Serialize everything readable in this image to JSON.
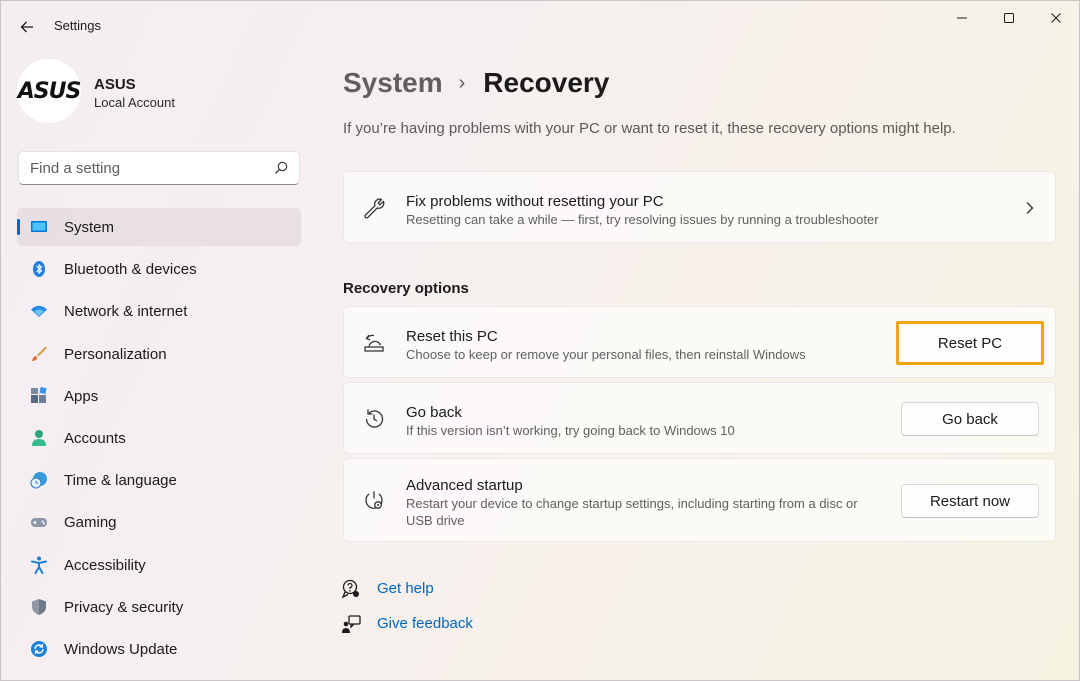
{
  "window": {
    "title": "Settings"
  },
  "profile": {
    "logo_text": "ASUS",
    "name": "ASUS",
    "account_type": "Local Account"
  },
  "search": {
    "placeholder": "Find a setting"
  },
  "sidebar": {
    "items": [
      {
        "label": "System",
        "icon": "system-icon",
        "active": true
      },
      {
        "label": "Bluetooth & devices",
        "icon": "bluetooth-icon"
      },
      {
        "label": "Network & internet",
        "icon": "wifi-icon"
      },
      {
        "label": "Personalization",
        "icon": "brush-icon"
      },
      {
        "label": "Apps",
        "icon": "apps-icon"
      },
      {
        "label": "Accounts",
        "icon": "person-icon"
      },
      {
        "label": "Time & language",
        "icon": "clock-globe-icon"
      },
      {
        "label": "Gaming",
        "icon": "gamepad-icon"
      },
      {
        "label": "Accessibility",
        "icon": "accessibility-icon"
      },
      {
        "label": "Privacy & security",
        "icon": "shield-icon"
      },
      {
        "label": "Windows Update",
        "icon": "sync-icon"
      }
    ]
  },
  "main": {
    "breadcrumb": {
      "parent": "System",
      "separator": "›",
      "current": "Recovery"
    },
    "description": "If you’re having problems with your PC or want to reset it, these recovery options might help.",
    "fix_card": {
      "title": "Fix problems without resetting your PC",
      "subtitle": "Resetting can take a while — first, try resolving issues by running a troubleshooter"
    },
    "section_title": "Recovery options",
    "options": [
      {
        "title": "Reset this PC",
        "subtitle": "Choose to keep or remove your personal files, then reinstall Windows",
        "button": "Reset PC",
        "highlighted": true
      },
      {
        "title": "Go back",
        "subtitle": "If this version isn’t working, try going back to Windows 10",
        "button": "Go back"
      },
      {
        "title": "Advanced startup",
        "subtitle": "Restart your device to change startup settings, including starting from a disc or USB drive",
        "button": "Restart now"
      }
    ],
    "links": [
      {
        "label": "Get help",
        "icon": "help-chat-icon"
      },
      {
        "label": "Give feedback",
        "icon": "feedback-icon"
      }
    ]
  },
  "colors": {
    "accent": "#0067c0",
    "highlight_border": "#f3a413"
  }
}
